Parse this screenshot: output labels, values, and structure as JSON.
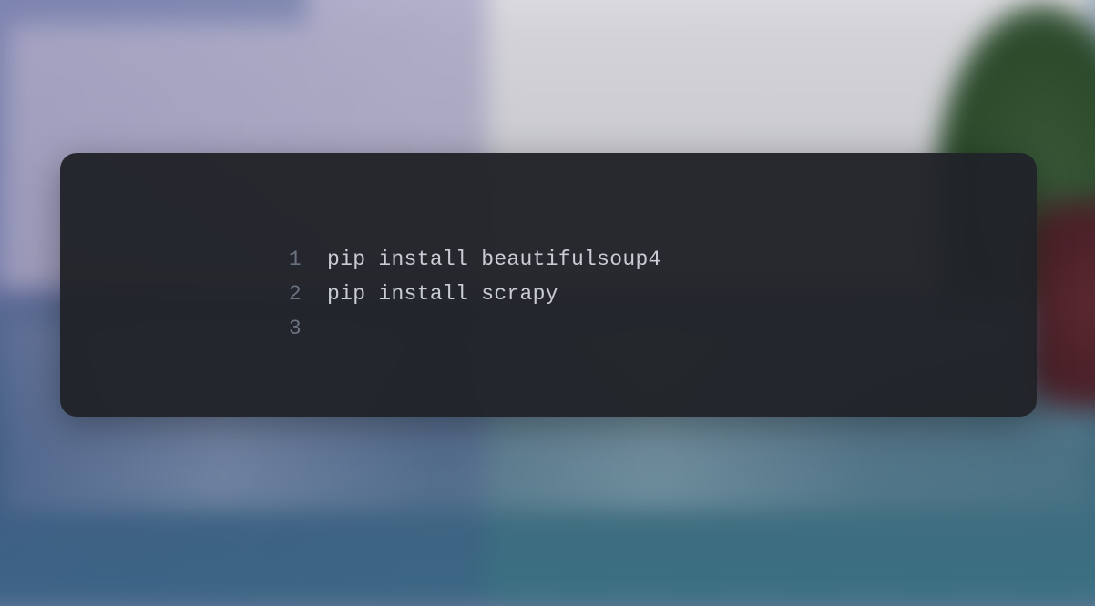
{
  "code": {
    "lines": [
      {
        "number": "1",
        "content": "pip install beautifulsoup4"
      },
      {
        "number": "2",
        "content": "pip install scrapy"
      },
      {
        "number": "3",
        "content": ""
      }
    ]
  }
}
